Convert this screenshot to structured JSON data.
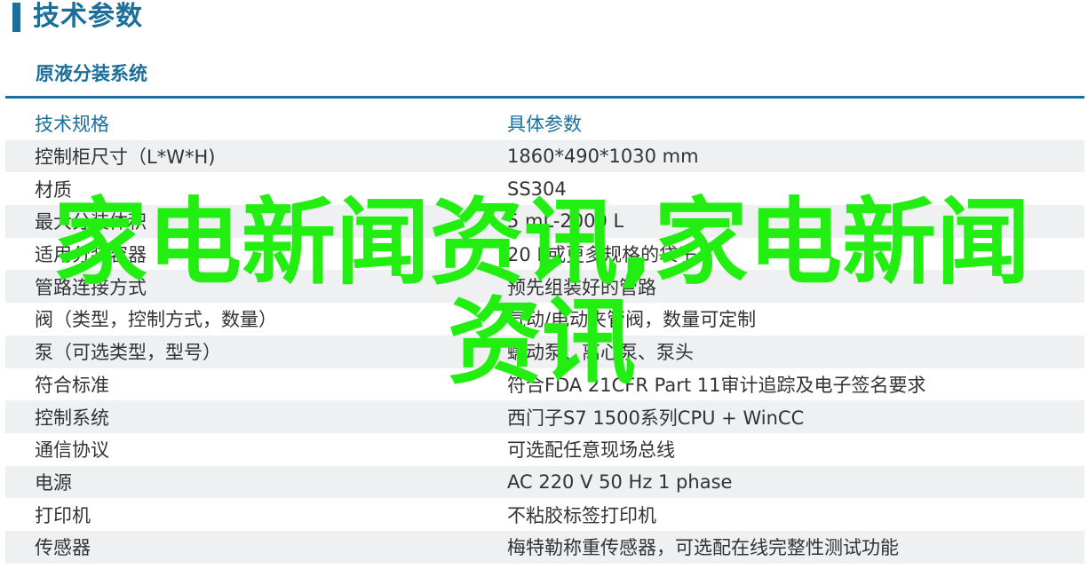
{
  "page": {
    "title": "技术参数",
    "section_title": "原液分装系统"
  },
  "table": {
    "headers": [
      "技术规格",
      "具体参数"
    ],
    "rows": [
      [
        "控制柜尺寸（L*W*H)",
        "1860*490*1030 mm"
      ],
      [
        "材质",
        "SS304"
      ],
      [
        "最大分装体积",
        "5 mL-2000 L"
      ],
      [
        "适用分装容器",
        "20 L或更多规格的袋子"
      ],
      [
        "管路连接方式",
        "预先组装好的管路"
      ],
      [
        "阀（类型，控制方式，数量）",
        "气动/电动夹管阀，数量可定制"
      ],
      [
        "泵（可选类型，型号）",
        "蠕动泵、离心泵、泵头"
      ],
      [
        "符合标准",
        "符合FDA 21CFR Part 11审计追踪及电子签名要求"
      ],
      [
        "控制系统",
        "西门子S7 1500系列CPU + WinCC"
      ],
      [
        "通信协议",
        "可选配任意现场总线"
      ],
      [
        "电源",
        "AC 220 V 50 Hz 1 phase"
      ],
      [
        "打印机",
        "不粘胶标签打印机"
      ],
      [
        "传感器",
        "梅特勒称重传感器，可选配在线完整性测试功能"
      ]
    ]
  },
  "watermark": {
    "text": "家电新闻资讯,家电新闻资讯",
    "color": "#22ee11"
  },
  "colors": {
    "accent": "#1b6f9a",
    "row_alt": "#eef0f1"
  }
}
